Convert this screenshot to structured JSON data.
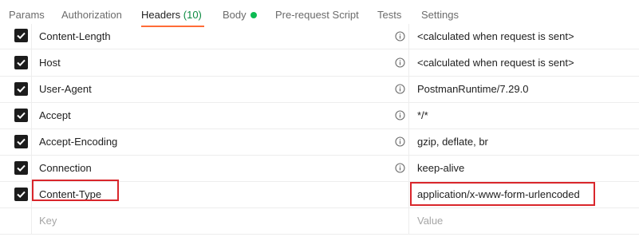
{
  "tabs": [
    {
      "label": "Params",
      "active": false
    },
    {
      "label": "Authorization",
      "active": false
    },
    {
      "label": "Headers",
      "count": "(10)",
      "active": true
    },
    {
      "label": "Body",
      "active": false,
      "indicator": "green-dot"
    },
    {
      "label": "Pre-request Script",
      "active": false
    },
    {
      "label": "Tests",
      "active": false
    },
    {
      "label": "Settings",
      "active": false
    }
  ],
  "headers": [
    {
      "key": "Content-Length",
      "value": "<calculated when request is sent>",
      "checked": true,
      "info": true
    },
    {
      "key": "Host",
      "value": "<calculated when request is sent>",
      "checked": true,
      "info": true
    },
    {
      "key": "User-Agent",
      "value": "PostmanRuntime/7.29.0",
      "checked": true,
      "info": true
    },
    {
      "key": "Accept",
      "value": "*/*",
      "checked": true,
      "info": true
    },
    {
      "key": "Accept-Encoding",
      "value": "gzip, deflate, br",
      "checked": true,
      "info": true
    },
    {
      "key": "Connection",
      "value": "keep-alive",
      "checked": true,
      "info": true
    },
    {
      "key": "Content-Type",
      "value": "application/x-www-form-urlencoded",
      "checked": true,
      "info": false,
      "highlighted": true
    }
  ],
  "new_row": {
    "key_placeholder": "Key",
    "value_placeholder": "Value"
  },
  "colors": {
    "active_tab_underline": "#ff6c37",
    "count": "#0b8a41",
    "body_indicator": "#0cbb52",
    "highlight_box": "#d9262b",
    "checkbox": "#1c1c1c"
  }
}
